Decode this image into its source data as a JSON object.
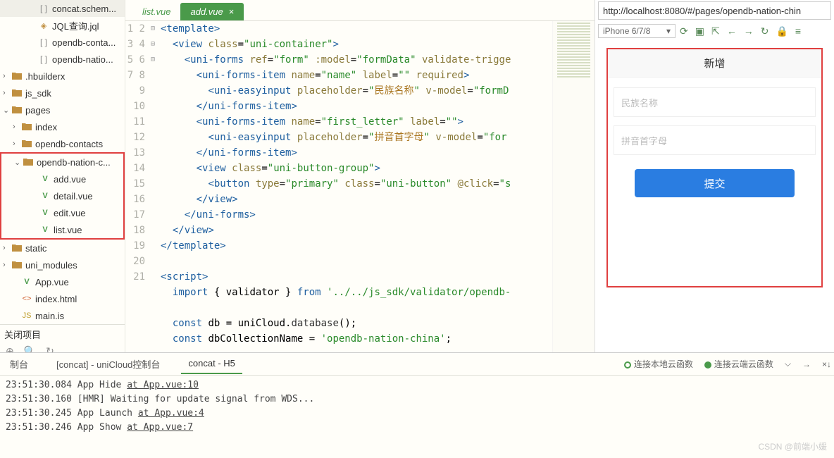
{
  "sidebar": {
    "items": [
      {
        "indent": 38,
        "icon": "bracket",
        "label": "concat.schem..."
      },
      {
        "indent": 38,
        "icon": "jql",
        "label": "JQL查询.jql"
      },
      {
        "indent": 38,
        "icon": "bracket",
        "label": "opendb-conta..."
      },
      {
        "indent": 38,
        "icon": "bracket",
        "label": "opendb-natio..."
      },
      {
        "indent": 0,
        "arrow": "›",
        "icon": "folder",
        "label": ".hbuilderx"
      },
      {
        "indent": 0,
        "arrow": "›",
        "icon": "folder",
        "label": "js_sdk"
      },
      {
        "indent": 0,
        "arrow": "⌄",
        "icon": "folder-open",
        "label": "pages"
      },
      {
        "indent": 14,
        "arrow": "›",
        "icon": "folder",
        "label": "index"
      },
      {
        "indent": 14,
        "arrow": "›",
        "icon": "folder",
        "label": "opendb-contacts"
      },
      {
        "indent": 14,
        "arrow": "⌄",
        "icon": "folder-open",
        "label": "opendb-nation-c...",
        "hl": true
      },
      {
        "indent": 38,
        "icon": "vue",
        "label": "add.vue",
        "hl": true
      },
      {
        "indent": 38,
        "icon": "vue",
        "label": "detail.vue",
        "hl": true
      },
      {
        "indent": 38,
        "icon": "vue",
        "label": "edit.vue",
        "hl": true
      },
      {
        "indent": 38,
        "icon": "vue",
        "label": "list.vue",
        "hl": true
      },
      {
        "indent": 0,
        "arrow": "›",
        "icon": "folder",
        "label": "static"
      },
      {
        "indent": 0,
        "arrow": "›",
        "icon": "folder",
        "label": "uni_modules"
      },
      {
        "indent": 14,
        "icon": "vue",
        "label": "App.vue"
      },
      {
        "indent": 14,
        "icon": "html",
        "label": "index.html"
      },
      {
        "indent": 14,
        "icon": "js",
        "label": "main.is"
      }
    ],
    "close_project": "关闭项目"
  },
  "tabs": {
    "inactive": "list.vue",
    "active": "add.vue"
  },
  "code_lines": [
    {
      "n": 1,
      "f": "⊟",
      "html": "<span class='tag'>&lt;template&gt;</span>"
    },
    {
      "n": 2,
      "f": "",
      "html": "  <span class='tag'>&lt;view</span> <span class='attr'>class</span>=<span class='str'>\"uni-container\"</span><span class='tag'>&gt;</span>"
    },
    {
      "n": 3,
      "f": "⊟",
      "html": "    <span class='tag'>&lt;uni-forms</span> <span class='attr'>ref</span>=<span class='str'>\"form\"</span> <span class='attr'>:model</span>=<span class='str'>\"formData\"</span> <span class='attr'>validate-trigge</span>"
    },
    {
      "n": 4,
      "f": "",
      "html": "      <span class='tag'>&lt;uni-forms-item</span> <span class='attr'>name</span>=<span class='str'>\"name\"</span> <span class='attr'>label</span>=<span class='str'>\"\"</span> <span class='attr'>required</span><span class='tag'>&gt;</span>"
    },
    {
      "n": 5,
      "f": "",
      "html": "        <span class='tag'>&lt;uni-easyinput</span> <span class='attr'>placeholder</span>=<span class='str'>\"<span class='ch'>民族名称</span>\"</span> <span class='attr'>v-model</span>=<span class='str'>\"formD</span>"
    },
    {
      "n": 6,
      "f": "",
      "html": "      <span class='tag'>&lt;/uni-forms-item&gt;</span>"
    },
    {
      "n": 7,
      "f": "",
      "html": "      <span class='tag'>&lt;uni-forms-item</span> <span class='attr'>name</span>=<span class='str'>\"first_letter\"</span> <span class='attr'>label</span>=<span class='str'>\"\"</span><span class='tag'>&gt;</span>"
    },
    {
      "n": 8,
      "f": "",
      "html": "        <span class='tag'>&lt;uni-easyinput</span> <span class='attr'>placeholder</span>=<span class='str'>\"<span class='ch'>拼音首字母</span>\"</span> <span class='attr'>v-model</span>=<span class='str'>\"for</span>"
    },
    {
      "n": 9,
      "f": "",
      "html": "      <span class='tag'>&lt;/uni-forms-item&gt;</span>"
    },
    {
      "n": 10,
      "f": "",
      "html": "      <span class='tag'>&lt;view</span> <span class='attr'>class</span>=<span class='str'>\"uni-button-group\"</span><span class='tag'>&gt;</span>"
    },
    {
      "n": 11,
      "f": "",
      "html": "        <span class='tag'>&lt;button</span> <span class='attr'>type</span>=<span class='str'>\"primary\"</span> <span class='attr'>class</span>=<span class='str'>\"uni-button\"</span> <span class='attr'>@click</span>=<span class='str'>\"s</span>"
    },
    {
      "n": 12,
      "f": "",
      "html": "      <span class='tag'>&lt;/view&gt;</span>"
    },
    {
      "n": 13,
      "f": "",
      "html": "    <span class='tag'>&lt;/uni-forms&gt;</span>"
    },
    {
      "n": 14,
      "f": "",
      "html": "  <span class='tag'>&lt;/view&gt;</span>"
    },
    {
      "n": 15,
      "f": "",
      "html": "<span class='tag'>&lt;/template&gt;</span>"
    },
    {
      "n": 16,
      "f": "",
      "html": ""
    },
    {
      "n": 17,
      "f": "⊟",
      "html": "<span class='tag'>&lt;script&gt;</span>"
    },
    {
      "n": 18,
      "f": "",
      "html": "  <span class='kw'>import</span> { validator } <span class='kw'>from</span> <span class='str'>'../../js_sdk/validator/opendb-</span>"
    },
    {
      "n": 19,
      "f": "",
      "html": ""
    },
    {
      "n": 20,
      "f": "",
      "html": "  <span class='kw'>const</span> db = uniCloud.<span class='fn'>database</span>();"
    },
    {
      "n": 21,
      "f": "",
      "html": "  <span class='kw'>const</span> dbCollectionName = <span class='str'>'opendb-nation-china'</span>;"
    }
  ],
  "preview": {
    "url": "http://localhost:8080/#/pages/opendb-nation-chin",
    "device": "iPhone 6/7/8",
    "title": "新增",
    "input1": "民族名称",
    "input2": "拼音首字母",
    "button": "提交"
  },
  "console": {
    "tab1": "制台",
    "tab2": "[concat] - uniCloud控制台",
    "tab3": "concat - H5",
    "status1": "连接本地云函数",
    "status2": "连接云端云函数",
    "logs": [
      {
        "time": "23:51:30.084",
        "msg": "App Hide",
        "link": "at App.vue:10"
      },
      {
        "time": "23:51:30.160",
        "msg": "[HMR] Waiting for update signal from WDS...",
        "link": ""
      },
      {
        "time": "23:51:30.245",
        "msg": "App Launch",
        "link": "at App.vue:4"
      },
      {
        "time": "23:51:30.246",
        "msg": "App Show",
        "link": "at App.vue:7"
      }
    ]
  },
  "watermark": "CSDN @前端小媛"
}
